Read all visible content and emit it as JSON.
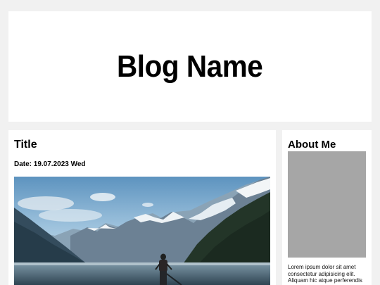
{
  "header": {
    "blog_name": "Blog Name"
  },
  "post": {
    "title": "Title",
    "date": "Date: 19.07.2023 Wed",
    "image_icon": "mountain-lake-photo"
  },
  "sidebar": {
    "about_title": "About Me",
    "about_text": "Lorem ipsum dolor sit amet consectetur adipisicing elit. Aliquam hic atque perferendis amet magnam"
  },
  "colors": {
    "page_background": "#f1f1f1",
    "card_background": "#ffffff",
    "photo_placeholder": "#a6a6a6"
  }
}
